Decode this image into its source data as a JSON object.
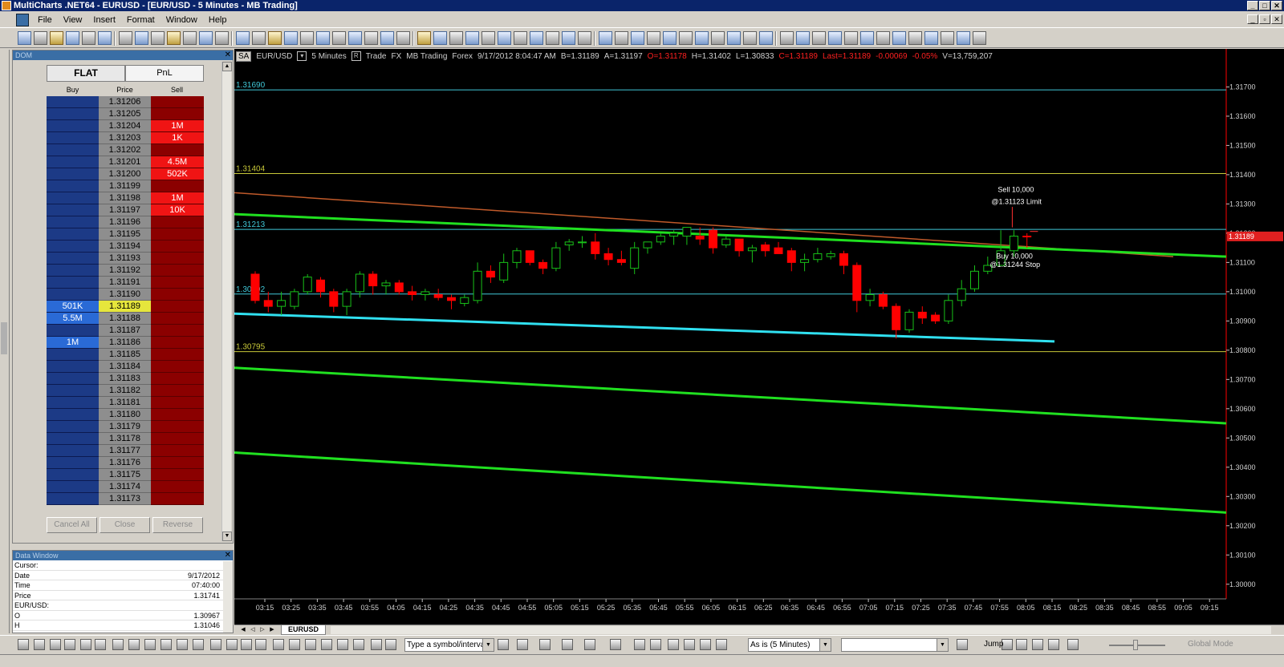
{
  "window": {
    "title": "MultiCharts .NET64 - EURUSD - [EUR/USD - 5 Minutes - MB Trading]"
  },
  "menu": [
    "File",
    "View",
    "Insert",
    "Format",
    "Window",
    "Help"
  ],
  "dom": {
    "status": "FLAT",
    "pnl_label": "PnL",
    "columns": {
      "buy": "Buy",
      "price": "Price",
      "sell": "Sell"
    },
    "rows": [
      {
        "buy": "",
        "price": "1.31206",
        "sell": "",
        "hi": ""
      },
      {
        "buy": "",
        "price": "1.31205",
        "sell": "",
        "hi": ""
      },
      {
        "buy": "",
        "price": "1.31204",
        "sell": "1M",
        "hi": "sell"
      },
      {
        "buy": "",
        "price": "1.31203",
        "sell": "1K",
        "hi": "sell"
      },
      {
        "buy": "",
        "price": "1.31202",
        "sell": "",
        "hi": ""
      },
      {
        "buy": "",
        "price": "1.31201",
        "sell": "4.5M",
        "hi": "sell"
      },
      {
        "buy": "",
        "price": "1.31200",
        "sell": "502K",
        "hi": "sell"
      },
      {
        "buy": "",
        "price": "1.31199",
        "sell": "",
        "hi": ""
      },
      {
        "buy": "",
        "price": "1.31198",
        "sell": "1M",
        "hi": "sell"
      },
      {
        "buy": "",
        "price": "1.31197",
        "sell": "10K",
        "hi": "sell"
      },
      {
        "buy": "",
        "price": "1.31196",
        "sell": "",
        "hi": ""
      },
      {
        "buy": "",
        "price": "1.31195",
        "sell": "",
        "hi": ""
      },
      {
        "buy": "",
        "price": "1.31194",
        "sell": "",
        "hi": ""
      },
      {
        "buy": "",
        "price": "1.31193",
        "sell": "",
        "hi": ""
      },
      {
        "buy": "",
        "price": "1.31192",
        "sell": "",
        "hi": ""
      },
      {
        "buy": "",
        "price": "1.31191",
        "sell": "",
        "hi": ""
      },
      {
        "buy": "",
        "price": "1.31190",
        "sell": "",
        "hi": ""
      },
      {
        "buy": "501K",
        "price": "1.31189",
        "sell": "",
        "hi": "buy price"
      },
      {
        "buy": "5.5M",
        "price": "1.31188",
        "sell": "",
        "hi": "buy"
      },
      {
        "buy": "",
        "price": "1.31187",
        "sell": "",
        "hi": ""
      },
      {
        "buy": "1M",
        "price": "1.31186",
        "sell": "",
        "hi": "buy"
      },
      {
        "buy": "",
        "price": "1.31185",
        "sell": "",
        "hi": ""
      },
      {
        "buy": "",
        "price": "1.31184",
        "sell": "",
        "hi": ""
      },
      {
        "buy": "",
        "price": "1.31183",
        "sell": "",
        "hi": ""
      },
      {
        "buy": "",
        "price": "1.31182",
        "sell": "",
        "hi": ""
      },
      {
        "buy": "",
        "price": "1.31181",
        "sell": "",
        "hi": ""
      },
      {
        "buy": "",
        "price": "1.31180",
        "sell": "",
        "hi": ""
      },
      {
        "buy": "",
        "price": "1.31179",
        "sell": "",
        "hi": ""
      },
      {
        "buy": "",
        "price": "1.31178",
        "sell": "",
        "hi": ""
      },
      {
        "buy": "",
        "price": "1.31177",
        "sell": "",
        "hi": ""
      },
      {
        "buy": "",
        "price": "1.31176",
        "sell": "",
        "hi": ""
      },
      {
        "buy": "",
        "price": "1.31175",
        "sell": "",
        "hi": ""
      },
      {
        "buy": "",
        "price": "1.31174",
        "sell": "",
        "hi": ""
      },
      {
        "buy": "",
        "price": "1.31173",
        "sell": "",
        "hi": ""
      }
    ],
    "buttons": {
      "cancel_all": "Cancel All",
      "close": "Close",
      "reverse": "Reverse"
    }
  },
  "data_window": {
    "rows": [
      {
        "k": "Cursor:",
        "v": ""
      },
      {
        "k": "Date",
        "v": "9/17/2012"
      },
      {
        "k": "Time",
        "v": "07:40:00"
      },
      {
        "k": "Price",
        "v": "1.31741"
      },
      {
        "k": "EUR/USD:",
        "v": ""
      },
      {
        "k": "O",
        "v": "1.30967"
      },
      {
        "k": "H",
        "v": "1.31046"
      }
    ]
  },
  "chart": {
    "status": {
      "sa": "SA",
      "symbol": "EUR/USD",
      "resolution": "5 Minutes",
      "r_box": "R",
      "trade": "Trade",
      "exchange": "FX",
      "broker": "MB Trading",
      "category": "Forex",
      "datetime": "9/17/2012  8:04:47 AM",
      "bid": "B=1.31189",
      "ask": "A=1.31197",
      "open": "O=1.31178",
      "high": "H=1.31402",
      "low": "L=1.30833",
      "close": "C=1.31189",
      "last": "Last=1.31189",
      "change": "-0.00069",
      "change_pct": "-0.05%",
      "volume": "V=13,759,207"
    },
    "y_ticks": [
      "1.31700",
      "1.31600",
      "1.31500",
      "1.31400",
      "1.31300",
      "1.31200",
      "1.31100",
      "1.31000",
      "1.30900",
      "1.30800",
      "1.30700",
      "1.30600",
      "1.30500",
      "1.30400",
      "1.30300",
      "1.30200",
      "1.30100",
      "1.30000"
    ],
    "x_ticks": [
      "03:15",
      "03:25",
      "03:35",
      "03:45",
      "03:55",
      "04:05",
      "04:15",
      "04:25",
      "04:35",
      "04:45",
      "04:55",
      "05:05",
      "05:15",
      "05:25",
      "05:35",
      "05:45",
      "05:55",
      "06:05",
      "06:15",
      "06:25",
      "06:35",
      "06:45",
      "06:55",
      "07:05",
      "07:15",
      "07:25",
      "07:35",
      "07:45",
      "07:55",
      "08:05",
      "08:15",
      "08:25",
      "08:35",
      "08:45",
      "08:55",
      "09:05",
      "09:15"
    ],
    "ylim": [
      1.2995,
      1.3183
    ],
    "level_lines": [
      {
        "label": "1.31690",
        "value": 1.3169,
        "color": "#40c8d8"
      },
      {
        "label": "1.31404",
        "value": 1.31404,
        "color": "#c8c838"
      },
      {
        "label": "1.31213",
        "value": 1.31213,
        "color": "#40c8d8"
      },
      {
        "label": "1.30992",
        "value": 1.30992,
        "color": "#40c8d8"
      },
      {
        "label": "1.30795",
        "value": 1.30795,
        "color": "#c8c838"
      }
    ],
    "last_price_label": "1.31189",
    "order_labels": {
      "sell_line1": "Sell 10,000",
      "sell_line2": "@1.31123 Limit",
      "buy_line1": "Buy 10,000",
      "buy_line2": "@1.31244 Stop"
    },
    "candles": [
      {
        "o": 1.3106,
        "h": 1.3107,
        "l": 1.3096,
        "c": 1.3097
      },
      {
        "o": 1.3097,
        "h": 1.31,
        "l": 1.3093,
        "c": 1.3095
      },
      {
        "o": 1.3095,
        "h": 1.31,
        "l": 1.3092,
        "c": 1.3097
      },
      {
        "o": 1.3095,
        "h": 1.3101,
        "l": 1.3094,
        "c": 1.31
      },
      {
        "o": 1.31,
        "h": 1.3106,
        "l": 1.3099,
        "c": 1.3105
      },
      {
        "o": 1.3104,
        "h": 1.3105,
        "l": 1.3098,
        "c": 1.31
      },
      {
        "o": 1.31,
        "h": 1.3101,
        "l": 1.3093,
        "c": 1.3095
      },
      {
        "o": 1.3095,
        "h": 1.3101,
        "l": 1.3092,
        "c": 1.31
      },
      {
        "o": 1.31,
        "h": 1.3107,
        "l": 1.3098,
        "c": 1.3106
      },
      {
        "o": 1.3106,
        "h": 1.3107,
        "l": 1.3099,
        "c": 1.3102
      },
      {
        "o": 1.3102,
        "h": 1.3104,
        "l": 1.3099,
        "c": 1.3103
      },
      {
        "o": 1.3103,
        "h": 1.3104,
        "l": 1.3099,
        "c": 1.31
      },
      {
        "o": 1.31,
        "h": 1.3102,
        "l": 1.3097,
        "c": 1.3099
      },
      {
        "o": 1.3099,
        "h": 1.3101,
        "l": 1.3097,
        "c": 1.31
      },
      {
        "o": 1.3099,
        "h": 1.3101,
        "l": 1.3097,
        "c": 1.3098
      },
      {
        "o": 1.3098,
        "h": 1.3099,
        "l": 1.3094,
        "c": 1.3097
      },
      {
        "o": 1.3096,
        "h": 1.3099,
        "l": 1.3095,
        "c": 1.3098
      },
      {
        "o": 1.3097,
        "h": 1.311,
        "l": 1.3096,
        "c": 1.3107
      },
      {
        "o": 1.3107,
        "h": 1.3109,
        "l": 1.3103,
        "c": 1.3105
      },
      {
        "o": 1.3104,
        "h": 1.3113,
        "l": 1.3103,
        "c": 1.311
      },
      {
        "o": 1.311,
        "h": 1.3115,
        "l": 1.3108,
        "c": 1.3114
      },
      {
        "o": 1.3114,
        "h": 1.3114,
        "l": 1.3109,
        "c": 1.311
      },
      {
        "o": 1.311,
        "h": 1.3111,
        "l": 1.3106,
        "c": 1.3108
      },
      {
        "o": 1.3108,
        "h": 1.3117,
        "l": 1.3107,
        "c": 1.3115
      },
      {
        "o": 1.3116,
        "h": 1.3118,
        "l": 1.3114,
        "c": 1.3117
      },
      {
        "o": 1.3117,
        "h": 1.3119,
        "l": 1.3115,
        "c": 1.3117
      },
      {
        "o": 1.3117,
        "h": 1.312,
        "l": 1.3111,
        "c": 1.3113
      },
      {
        "o": 1.3113,
        "h": 1.3115,
        "l": 1.3109,
        "c": 1.3111
      },
      {
        "o": 1.3111,
        "h": 1.3114,
        "l": 1.3109,
        "c": 1.311
      },
      {
        "o": 1.3108,
        "h": 1.3117,
        "l": 1.3106,
        "c": 1.3115
      },
      {
        "o": 1.3115,
        "h": 1.3117,
        "l": 1.3113,
        "c": 1.3117
      },
      {
        "o": 1.3117,
        "h": 1.312,
        "l": 1.3116,
        "c": 1.3119
      },
      {
        "o": 1.3119,
        "h": 1.3121,
        "l": 1.3116,
        "c": 1.312
      },
      {
        "o": 1.3119,
        "h": 1.3122,
        "l": 1.3116,
        "c": 1.3122
      },
      {
        "o": 1.3119,
        "h": 1.3122,
        "l": 1.3116,
        "c": 1.3118
      },
      {
        "o": 1.3121,
        "h": 1.3122,
        "l": 1.3113,
        "c": 1.3115
      },
      {
        "o": 1.3116,
        "h": 1.3119,
        "l": 1.3115,
        "c": 1.3118
      },
      {
        "o": 1.3118,
        "h": 1.3118,
        "l": 1.3112,
        "c": 1.3114
      },
      {
        "o": 1.3114,
        "h": 1.3116,
        "l": 1.311,
        "c": 1.3115
      },
      {
        "o": 1.3116,
        "h": 1.3117,
        "l": 1.3112,
        "c": 1.3114
      },
      {
        "o": 1.3115,
        "h": 1.3117,
        "l": 1.3113,
        "c": 1.3113
      },
      {
        "o": 1.3114,
        "h": 1.3115,
        "l": 1.3107,
        "c": 1.311
      },
      {
        "o": 1.311,
        "h": 1.3113,
        "l": 1.3107,
        "c": 1.3111
      },
      {
        "o": 1.3111,
        "h": 1.3115,
        "l": 1.311,
        "c": 1.3113
      },
      {
        "o": 1.3112,
        "h": 1.3114,
        "l": 1.3111,
        "c": 1.3113
      },
      {
        "o": 1.3113,
        "h": 1.3114,
        "l": 1.3106,
        "c": 1.3109
      },
      {
        "o": 1.3109,
        "h": 1.311,
        "l": 1.3093,
        "c": 1.3097
      },
      {
        "o": 1.3097,
        "h": 1.3101,
        "l": 1.3095,
        "c": 1.3099
      },
      {
        "o": 1.3099,
        "h": 1.31,
        "l": 1.3094,
        "c": 1.3095
      },
      {
        "o": 1.3095,
        "h": 1.3096,
        "l": 1.3084,
        "c": 1.3087
      },
      {
        "o": 1.3087,
        "h": 1.3094,
        "l": 1.3086,
        "c": 1.3093
      },
      {
        "o": 1.3093,
        "h": 1.3095,
        "l": 1.3089,
        "c": 1.3091
      },
      {
        "o": 1.3092,
        "h": 1.3093,
        "l": 1.3089,
        "c": 1.309
      },
      {
        "o": 1.309,
        "h": 1.3099,
        "l": 1.3089,
        "c": 1.3097
      },
      {
        "o": 1.3097,
        "h": 1.3104,
        "l": 1.3095,
        "c": 1.3101
      },
      {
        "o": 1.3101,
        "h": 1.3109,
        "l": 1.31,
        "c": 1.3107
      },
      {
        "o": 1.3107,
        "h": 1.3112,
        "l": 1.3106,
        "c": 1.3109
      },
      {
        "o": 1.3109,
        "h": 1.3121,
        "l": 1.3109,
        "c": 1.3114
      },
      {
        "o": 1.3114,
        "h": 1.3121,
        "l": 1.3112,
        "c": 1.3119
      },
      {
        "o": 1.3119,
        "h": 1.312,
        "l": 1.3115,
        "c": 1.31189
      }
    ],
    "colors": {
      "up": "#18c018",
      "down": "#ff0000"
    }
  },
  "sheet_tab": "EURUSD",
  "bottom": {
    "symbol_placeholder": "Type a symbol/interval",
    "resolution_value": "As is (5 Minutes)",
    "jump_label": "Jump",
    "global_mode_label": "Global Mode"
  }
}
